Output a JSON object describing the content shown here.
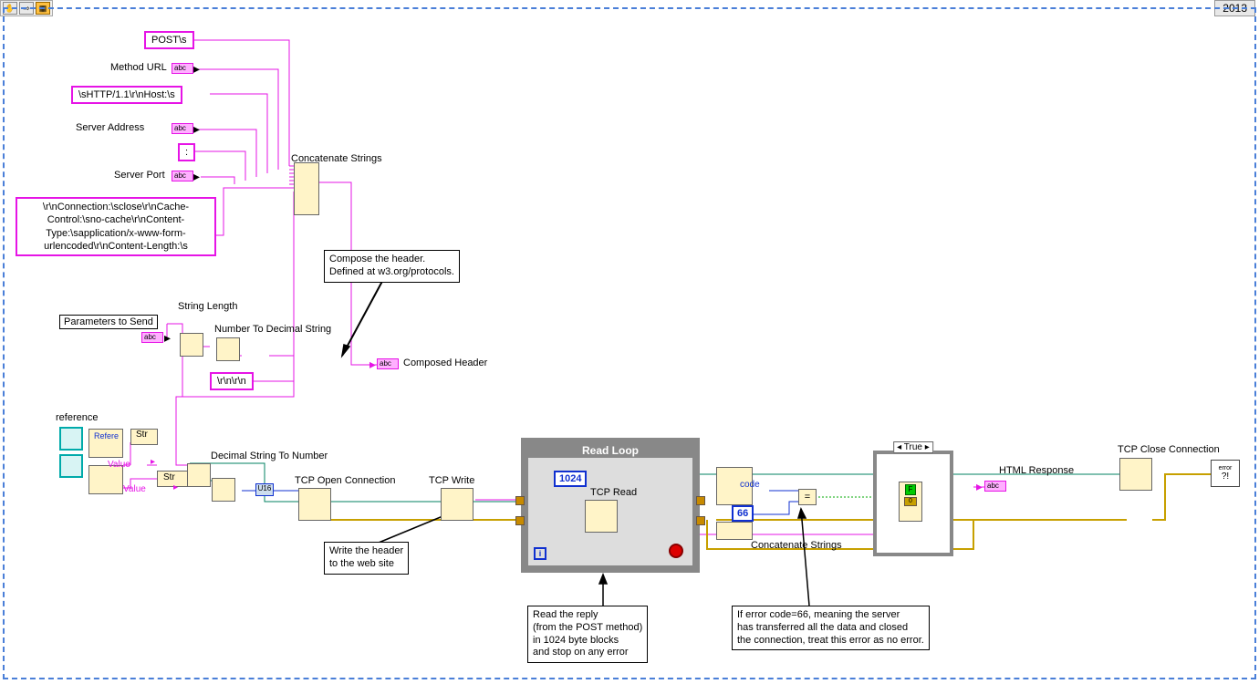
{
  "year": "2013",
  "toolbar": {
    "hand": "✋",
    "arrow": "⇨",
    "highlight": "▦"
  },
  "constants": {
    "post": "POST\\s",
    "http_host": "\\sHTTP/1.1\\r\\nHost:\\s",
    "colon": ":",
    "headers_block": "\\r\\nConnection:\\sclose\\r\\nCache-Control:\\sno-cache\\r\\nContent-Type:\\sapplication/x-www-form-urlencoded\\r\\nContent-Length:\\s",
    "crlf": "\\r\\n\\r\\n",
    "buf": "1024",
    "err66": "66"
  },
  "labels": {
    "method_url": "Method URL",
    "server_address": "Server Address",
    "server_port": "Server Port",
    "params": "Parameters to Send",
    "string_length": "String Length",
    "num_to_dec": "Number To Decimal String",
    "concat": "Concatenate Strings",
    "composed": "Composed Header",
    "dec_to_num": "Decimal String To Number",
    "tcp_open": "TCP Open Connection",
    "tcp_write": "TCP Write",
    "tcp_read": "TCP Read",
    "tcp_close": "TCP Close Connection",
    "read_loop": "Read Loop",
    "concat2": "Concatenate Strings",
    "html_resp": "HTML Response",
    "code": "code",
    "reference": "reference",
    "str": "Str",
    "value": "Value",
    "case_true": "True",
    "error": "error"
  },
  "comments": {
    "compose": "Compose the header.\nDefined at w3.org/protocols.",
    "write_header": "Write the header\nto the web site",
    "read_reply": "Read the reply\n(from the POST method)\nin 1024 byte blocks\nand stop on any error",
    "err66": "If error code=66, meaning the server\nhas transferred all the data and closed\nthe connection, treat this error as no error."
  }
}
